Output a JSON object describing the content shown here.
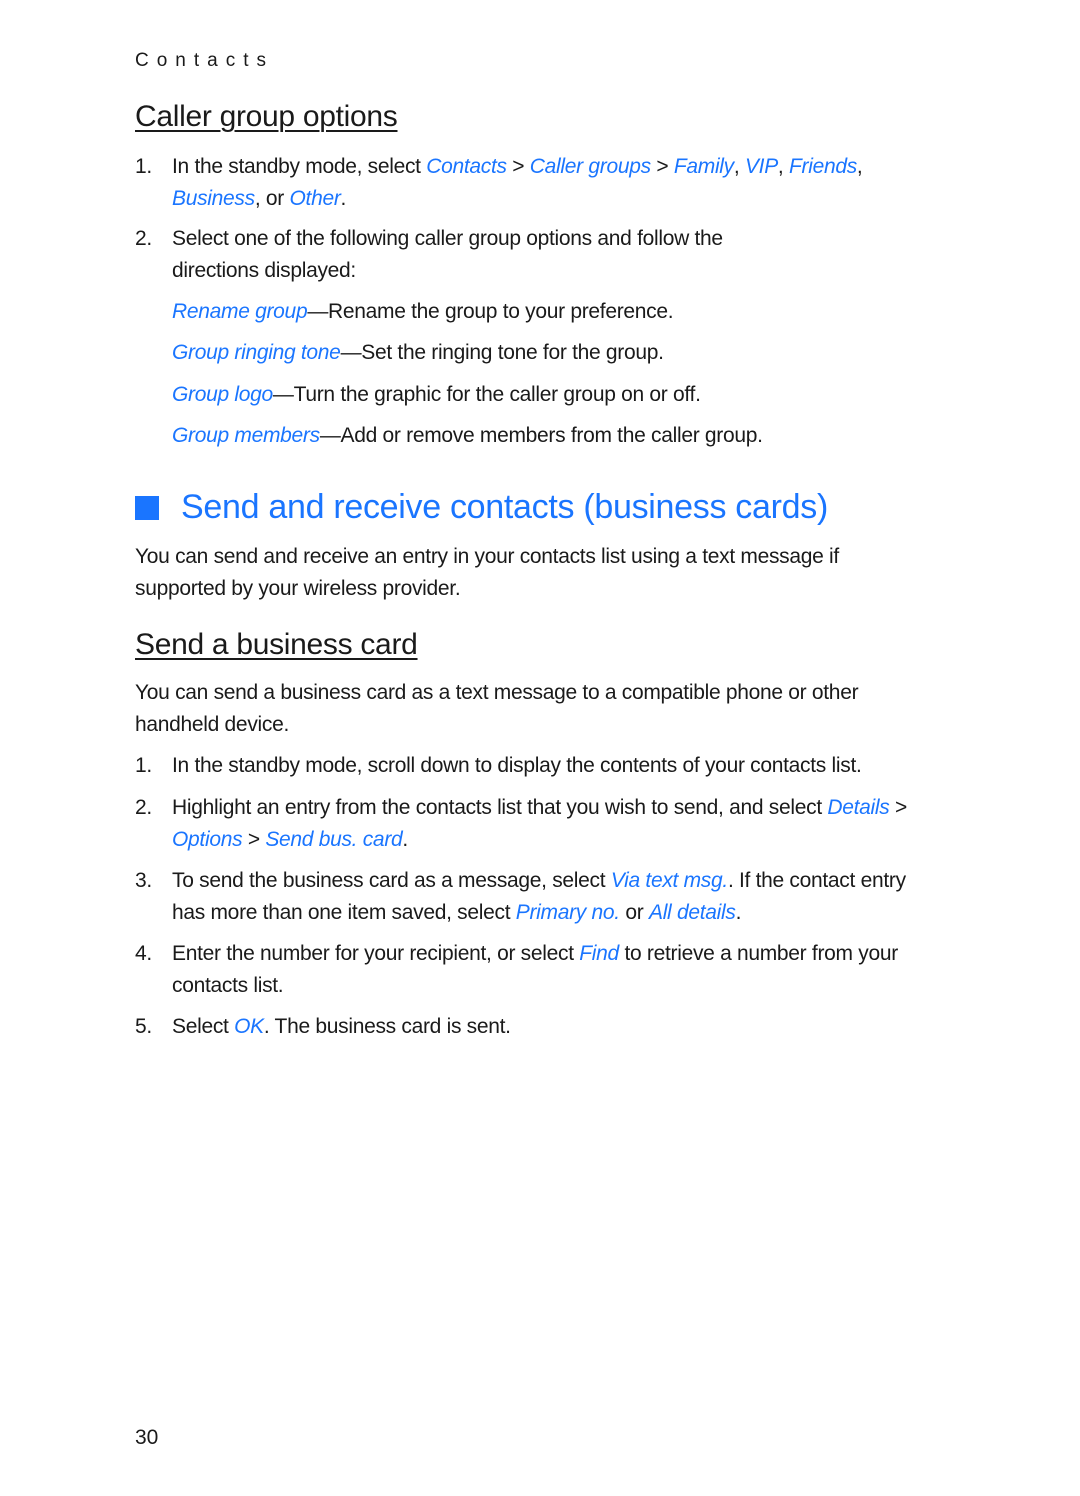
{
  "running_head": "Contacts",
  "page_number": "30",
  "colors": {
    "accent": "#1a75ff",
    "text": "#1a1a1a"
  },
  "caller_group": {
    "heading": "Caller group options",
    "steps": [
      {
        "num": "1.",
        "parts": [
          {
            "t": "In the standby mode, select "
          },
          {
            "t": "Contacts",
            "link": true
          },
          {
            "t": " > "
          },
          {
            "t": "Caller groups",
            "link": true
          },
          {
            "t": " > "
          },
          {
            "t": "Family",
            "link": true
          },
          {
            "t": ", "
          },
          {
            "t": "VIP",
            "link": true
          },
          {
            "t": ", "
          },
          {
            "t": "Friends",
            "link": true
          },
          {
            "t": ", "
          },
          {
            "t": "Business",
            "link": true
          },
          {
            "t": ", or "
          },
          {
            "t": "Other",
            "link": true
          },
          {
            "t": "."
          }
        ]
      },
      {
        "num": "2.",
        "parts": [
          {
            "t": "Select one of the following caller group options and follow the directions displayed:"
          }
        ]
      }
    ],
    "options": [
      {
        "name": "Rename group",
        "desc": "—Rename the group to your preference."
      },
      {
        "name": "Group ringing tone",
        "desc": "—Set the ringing tone for the group."
      },
      {
        "name": "Group logo",
        "desc": "—Turn the graphic for the caller group on or off."
      },
      {
        "name": "Group members",
        "desc": "—Add or remove members from the caller group."
      }
    ]
  },
  "send_receive": {
    "heading": "Send and receive contacts (business cards)",
    "intro": "You can send and receive an entry in your contacts list using a text message if supported by your wireless provider."
  },
  "send_card": {
    "heading": "Send a business card",
    "intro": "You can send a business card as a text message to a compatible phone or other handheld device.",
    "steps": [
      {
        "num": "1.",
        "parts": [
          {
            "t": "In the standby mode, scroll down to display the contents of your contacts list."
          }
        ]
      },
      {
        "num": "2.",
        "parts": [
          {
            "t": "Highlight an entry from the contacts list that you wish to send, and select "
          },
          {
            "t": "Details",
            "link": true
          },
          {
            "t": " > "
          },
          {
            "t": "Options",
            "link": true
          },
          {
            "t": " > "
          },
          {
            "t": "Send bus. card",
            "link": true
          },
          {
            "t": "."
          }
        ]
      },
      {
        "num": "3.",
        "parts": [
          {
            "t": "To send the business card as a message, select "
          },
          {
            "t": "Via text msg.",
            "link": true
          },
          {
            "t": ". If the contact entry has more than one item saved, select "
          },
          {
            "t": "Primary no.",
            "link": true
          },
          {
            "t": " or "
          },
          {
            "t": "All details",
            "link": true
          },
          {
            "t": "."
          }
        ]
      },
      {
        "num": "4.",
        "parts": [
          {
            "t": "Enter the number for your recipient, or select "
          },
          {
            "t": "Find",
            "link": true
          },
          {
            "t": " to retrieve a number from your contacts list."
          }
        ]
      },
      {
        "num": "5.",
        "parts": [
          {
            "t": "Select "
          },
          {
            "t": "OK",
            "link": true
          },
          {
            "t": ". The business card is sent."
          }
        ]
      }
    ]
  }
}
